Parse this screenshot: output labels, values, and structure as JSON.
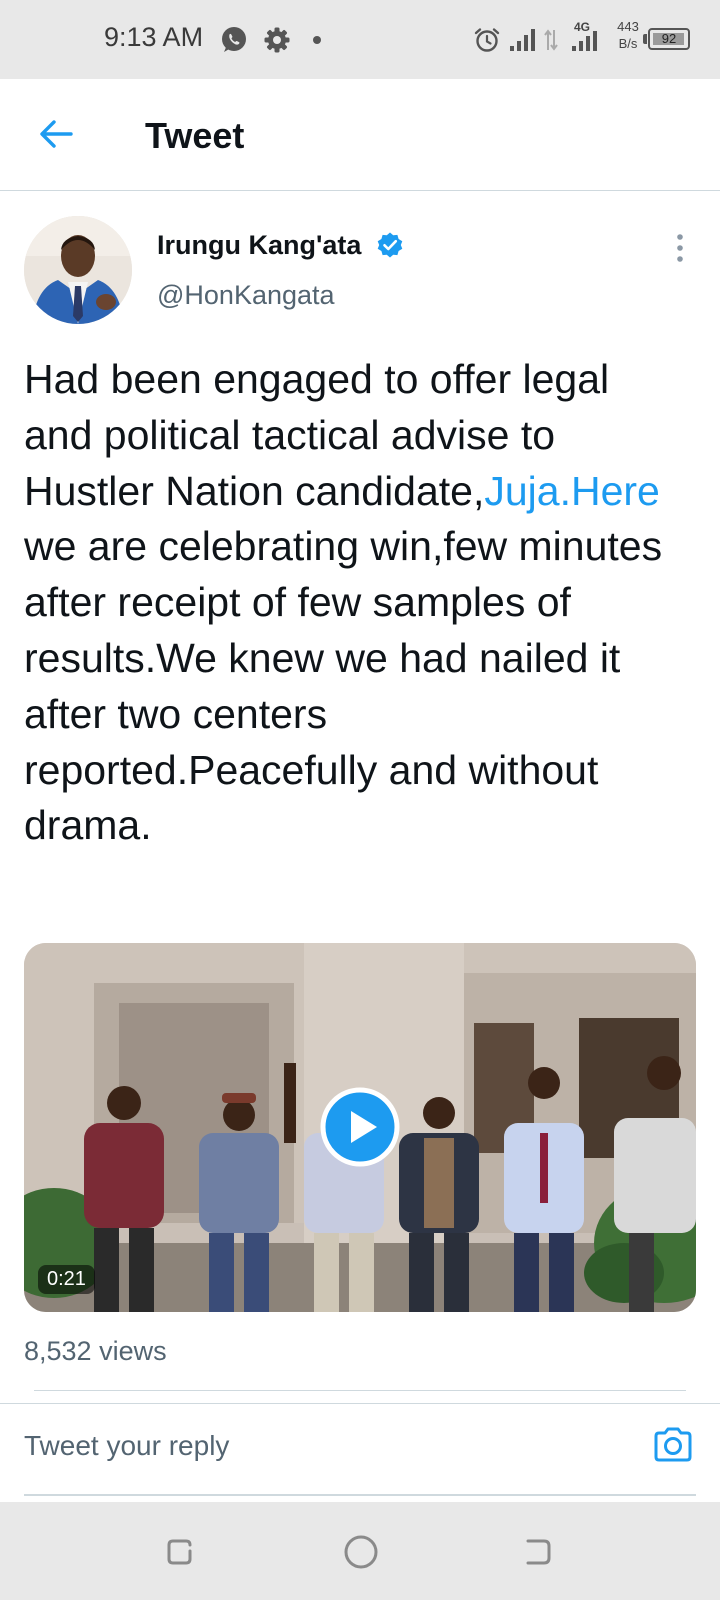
{
  "status_bar": {
    "time": "9:13 AM",
    "network_type": "4G",
    "speed_value": "443",
    "speed_unit": "B/s",
    "battery": "92",
    "icons": [
      "whatsapp-icon",
      "gear-icon",
      "alarm-icon",
      "signal-icon",
      "sim-icon",
      "signal-4g-icon",
      "battery-icon"
    ]
  },
  "header": {
    "title": "Tweet",
    "back_icon": "arrow-left-icon"
  },
  "tweet": {
    "author_name": "Irungu Kang'ata",
    "author_handle": "@HonKangata",
    "verified": true,
    "text_before_link": "Had been engaged to offer legal and political tactical advise to Hustler Nation candidate,",
    "link_text": "Juja.Here",
    "text_after_link": " we are celebrating win,few minutes after receipt of few samples of results.We knew we had nailed it after two centers reported.Peacefully and without drama.",
    "video_duration": "0:21",
    "views": "8,532 views"
  },
  "reply": {
    "placeholder": "Tweet your reply",
    "camera_icon": "camera-icon"
  },
  "colors": {
    "accent": "#1d9bf0",
    "text_primary": "#0f1419",
    "text_secondary": "#536471",
    "divider": "#cfd9de",
    "system_bar": "#e8e8e8"
  },
  "nav_bar": {
    "icons": [
      "recent-apps-icon",
      "home-icon",
      "back-icon"
    ]
  }
}
